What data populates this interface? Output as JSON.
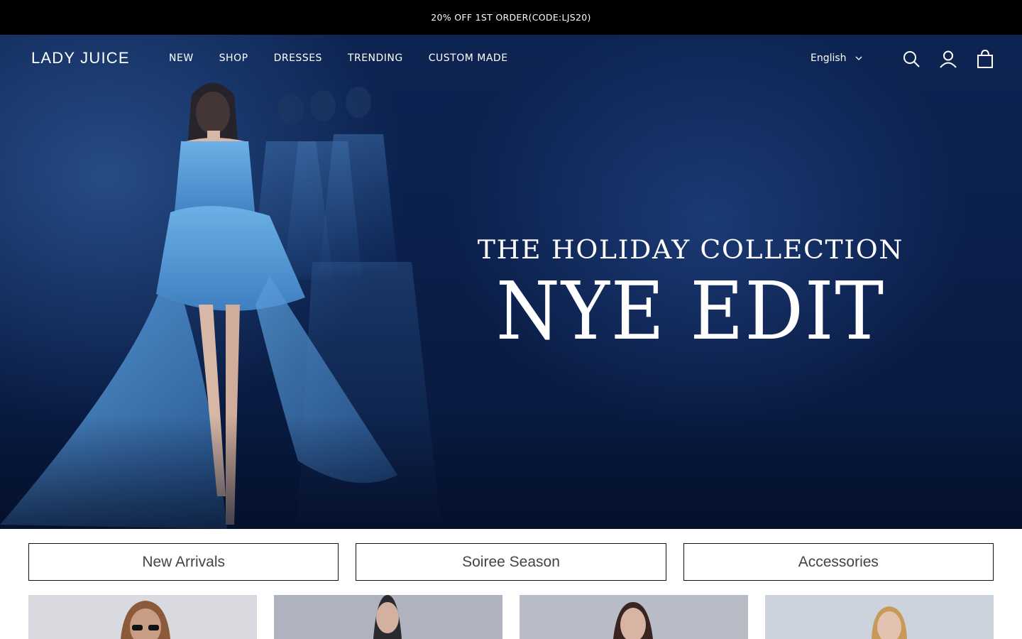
{
  "announcement": {
    "text": "20% OFF 1ST ORDER(CODE:LJS20)"
  },
  "header": {
    "logo": "LADY JUICE",
    "menu": [
      {
        "label": "NEW"
      },
      {
        "label": "SHOP"
      },
      {
        "label": "DRESSES"
      },
      {
        "label": "TRENDING"
      },
      {
        "label": "CUSTOM MADE"
      }
    ],
    "language": "English",
    "icons": [
      "search-icon",
      "account-icon",
      "cart-icon"
    ]
  },
  "hero": {
    "subtitle": "THE HOLIDAY COLLECTION",
    "title": "NYE EDIT"
  },
  "category_tabs": [
    {
      "label": "New Arrivals"
    },
    {
      "label": "Soiree Season"
    },
    {
      "label": "Accessories"
    }
  ],
  "colors": {
    "announcement_bg": "#000000",
    "hero_bg": "#0b1f4a",
    "dress_blue": "#4a8fd0"
  }
}
